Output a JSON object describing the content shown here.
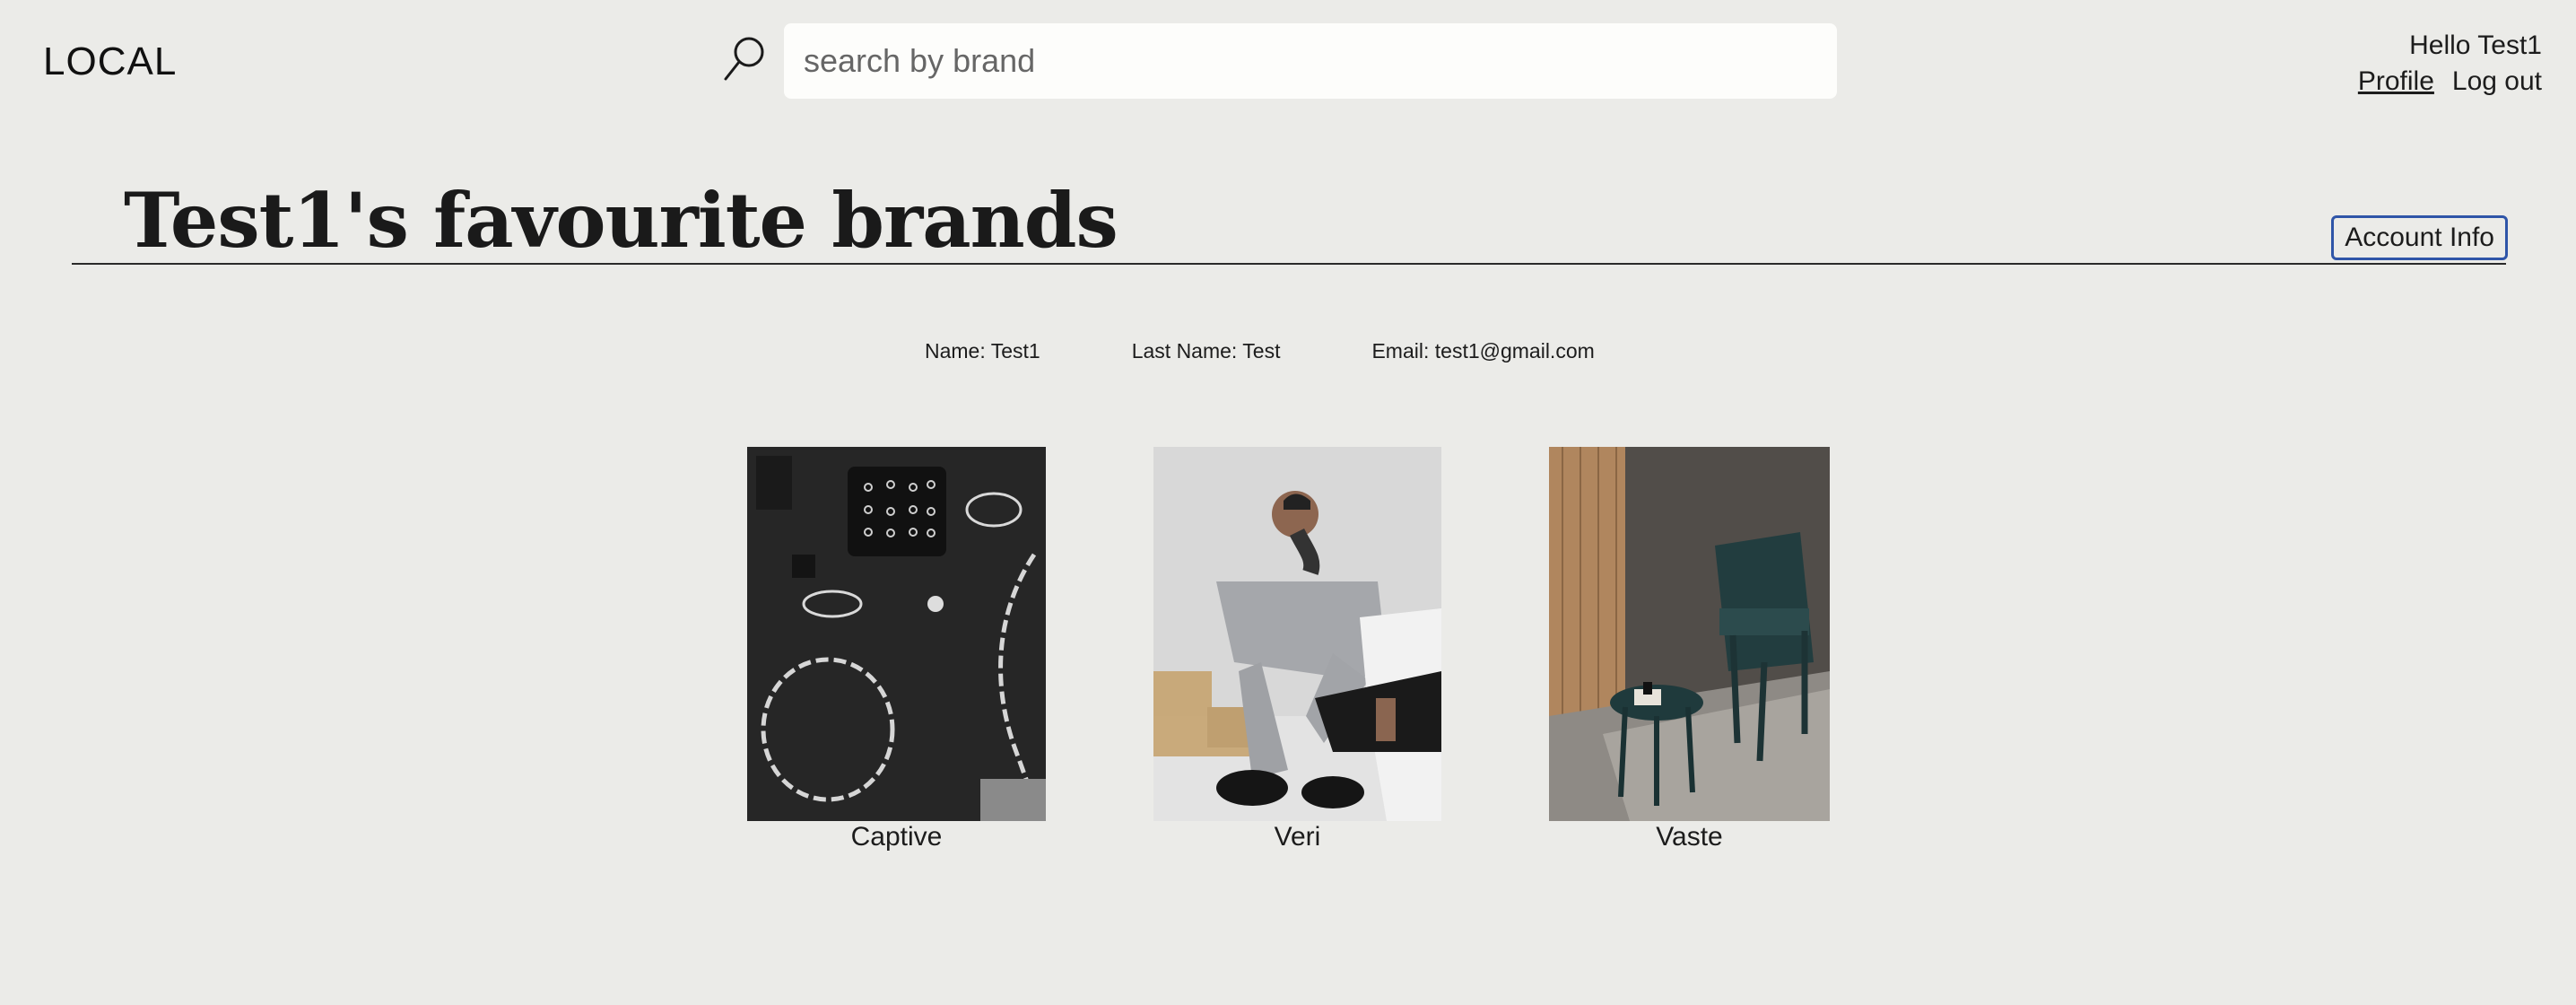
{
  "header": {
    "logo": "LOCAL",
    "search": {
      "placeholder": "search by brand",
      "value": ""
    },
    "greeting": "Hello Test1",
    "profile_label": "Profile",
    "logout_label": "Log out"
  },
  "title": {
    "text": "Test1's favourite brands",
    "account_info_label": "Account Info"
  },
  "account": {
    "name": "Name: Test1",
    "last_name": "Last Name: Test",
    "email": "Email: test1@gmail.com"
  },
  "brands": [
    {
      "name": "Captive",
      "image": "silver chain jewelry on black surface"
    },
    {
      "name": "Veri",
      "image": "man in grey outfit sitting on bricks"
    },
    {
      "name": "Vaste",
      "image": "teal chair and side table in room"
    }
  ],
  "colors": {
    "background": "#ebebe8",
    "search_bg": "#fdfdfb",
    "button_border": "#2f55a8",
    "text": "#1c1c1c"
  }
}
